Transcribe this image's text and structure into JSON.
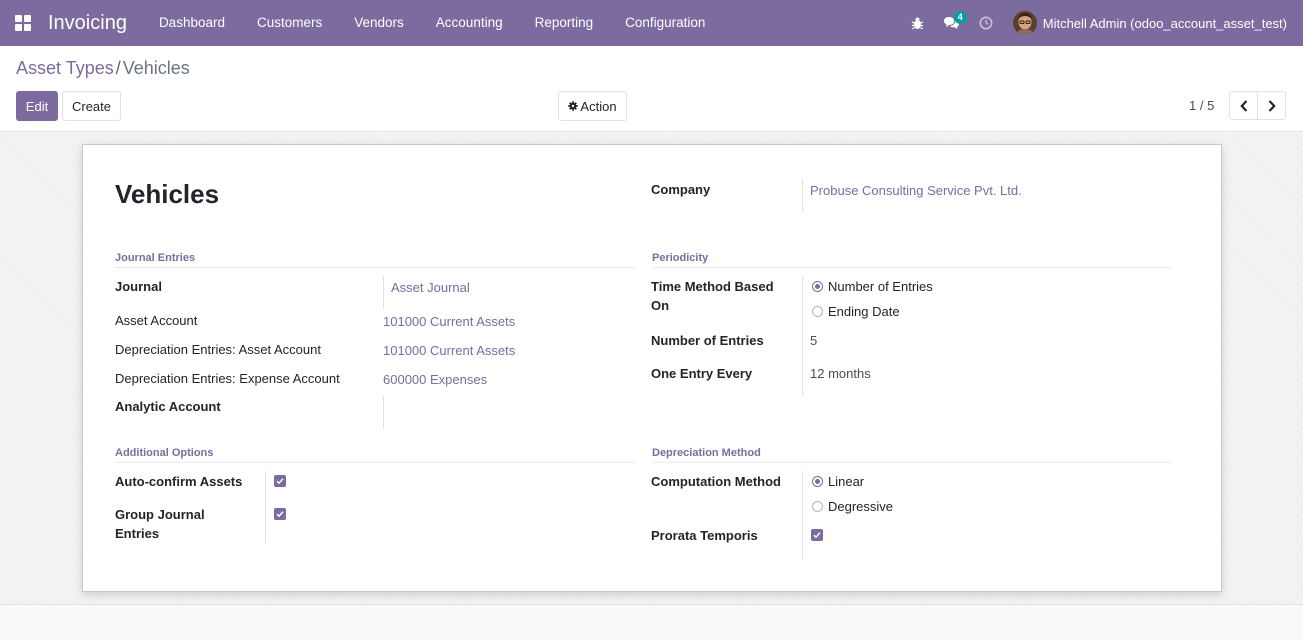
{
  "navbar": {
    "app_name": "Invoicing",
    "menu": [
      "Dashboard",
      "Customers",
      "Vendors",
      "Accounting",
      "Reporting",
      "Configuration"
    ],
    "messages_badge": "4",
    "user_name": "Mitchell Admin (odoo_account_asset_test)"
  },
  "breadcrumb": {
    "parent": "Asset Types",
    "separator": "/",
    "current": "Vehicles"
  },
  "buttons": {
    "edit": "Edit",
    "create": "Create",
    "action": "Action"
  },
  "pager": {
    "value": "1 / 5"
  },
  "form": {
    "name": "Vehicles",
    "company_label": "Company",
    "company_value": "Probuse Consulting Service Pvt. Ltd.",
    "journal_entries": {
      "title": "Journal Entries",
      "journal_label": "Journal",
      "journal_value": "Asset Journal",
      "asset_account_label": "Asset Account",
      "asset_account_value": "101000 Current Assets",
      "dep_asset_label": "Depreciation Entries: Asset Account",
      "dep_asset_value": "101000 Current Assets",
      "dep_expense_label": "Depreciation Entries: Expense Account",
      "dep_expense_value": "600000 Expenses",
      "analytic_label": "Analytic Account"
    },
    "periodicity": {
      "title": "Periodicity",
      "time_method_label_1": "Time Method Based",
      "time_method_label_2": "On",
      "option_number": "Number of Entries",
      "option_ending": "Ending Date",
      "selected": "Number of Entries",
      "number_label": "Number of Entries",
      "number_value": "5",
      "every_label": "One Entry Every",
      "every_value": "12 months"
    },
    "additional": {
      "title": "Additional Options",
      "auto_confirm_label": "Auto-confirm Assets",
      "auto_confirm": true,
      "group_label_1": "Group Journal",
      "group_label_2": "Entries",
      "group": true
    },
    "depreciation": {
      "title": "Depreciation Method",
      "computation_label": "Computation Method",
      "option_linear": "Linear",
      "option_degressive": "Degressive",
      "selected": "Linear",
      "prorata_label": "Prorata Temporis",
      "prorata": true
    }
  },
  "colors": {
    "brand": "#7c6b9e",
    "badge": "#00a09d"
  }
}
